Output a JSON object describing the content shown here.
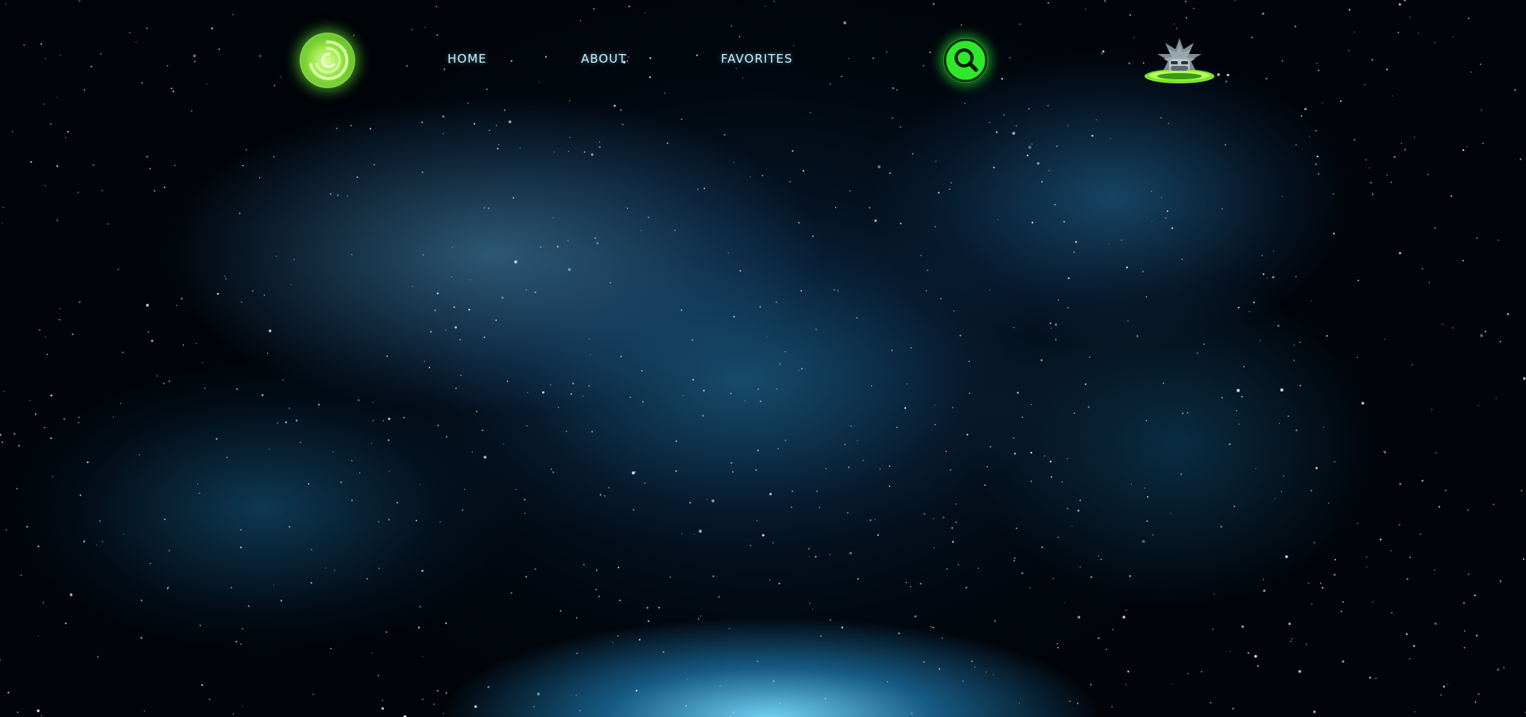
{
  "nav": {
    "logo_icon": "portal-logo-icon",
    "links": [
      {
        "label": "HOME"
      },
      {
        "label": "ABOUT"
      },
      {
        "label": "FAVORITES"
      }
    ],
    "search_icon": "search-icon",
    "avatar_icon": "rick-portal-avatar-icon"
  },
  "colors": {
    "accent_green": "#2ee82a",
    "nav_text": "#cdeff7",
    "background": "#010409"
  }
}
